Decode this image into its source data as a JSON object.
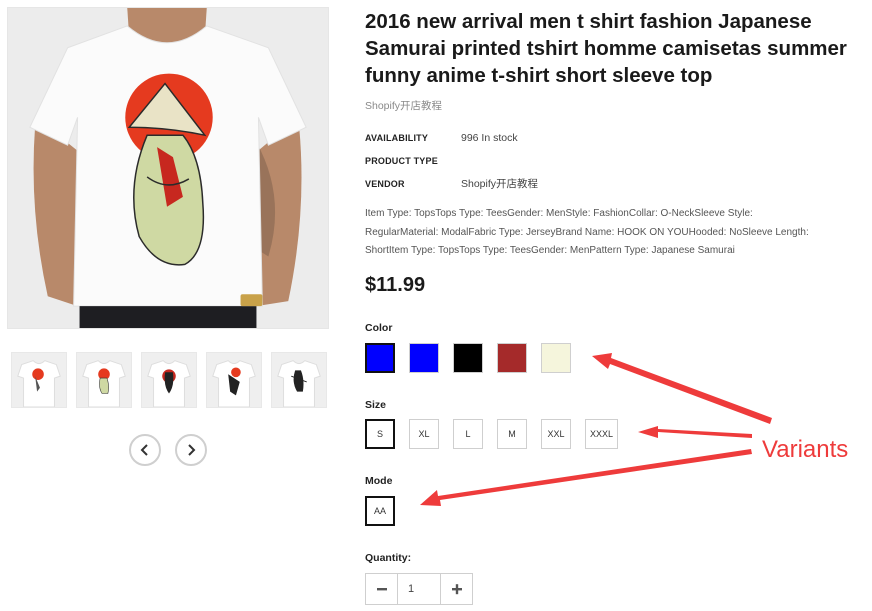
{
  "product": {
    "title": "2016 new arrival men t shirt fashion Japanese Samurai printed tshirt homme camisetas summer funny anime t-shirt short sleeve top",
    "vendor_line": "Shopify开店教程",
    "meta": [
      {
        "key": "AVAILABILITY",
        "value": "996 In stock"
      },
      {
        "key": "PRODUCT TYPE",
        "value": ""
      },
      {
        "key": "VENDOR",
        "value": "Shopify开店教程"
      }
    ],
    "description_lines": [
      "Item Type: TopsTops Type: TeesGender: MenStyle: FashionCollar: O-NeckSleeve Style:",
      "RegularMaterial: ModalFabric Type: JerseyBrand Name: HOOK ON YOUHooded: NoSleeve Length:",
      "ShortItem Type: TopsTops Type: TeesGender: MenPattern Type: Japanese Samurai"
    ],
    "price": "$11.99"
  },
  "options": {
    "color": {
      "label": "Color",
      "swatches": [
        {
          "name": "blue",
          "hex": "#0000ff",
          "selected": true
        },
        {
          "name": "blue",
          "hex": "#0000ff",
          "selected": false
        },
        {
          "name": "black",
          "hex": "#000000",
          "selected": false
        },
        {
          "name": "red",
          "hex": "#a52a2a",
          "selected": false
        },
        {
          "name": "beige",
          "hex": "#f5f5dc",
          "selected": false
        }
      ]
    },
    "size": {
      "label": "Size",
      "values": [
        "S",
        "XL",
        "L",
        "M",
        "XXL",
        "XXXL"
      ],
      "selected": "S"
    },
    "mode": {
      "label": "Mode",
      "values": [
        "AA"
      ],
      "selected": "AA"
    }
  },
  "quantity": {
    "label": "Quantity:",
    "value": "1"
  },
  "gallery": {
    "thumbnail_count": 5,
    "prev_icon": "chevron-left-icon",
    "next_icon": "chevron-right-icon"
  },
  "annotation": {
    "text": "Variants",
    "color": "#ee3b3b"
  },
  "colors": {
    "accent_red": "#ee3b3b",
    "border": "#cfcfcf",
    "selected_border": "#111111"
  }
}
